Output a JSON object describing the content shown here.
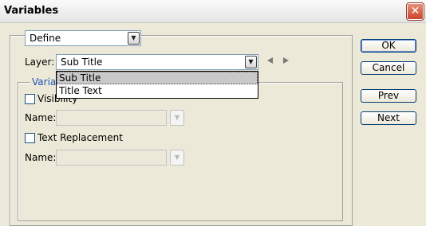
{
  "window": {
    "title": "Variables",
    "close_glyph": "✕"
  },
  "mode_select": {
    "value": "Define"
  },
  "layer": {
    "label": "Layer:",
    "value": "Sub Title",
    "options": [
      "Sub Title",
      "Title Text"
    ],
    "selected_index": 0
  },
  "variable_types": {
    "legend": "Variable Types",
    "legend_visible": "Variab",
    "visibility": {
      "label": "Visibility",
      "checked": false,
      "name_label": "Name:",
      "name_value": ""
    },
    "text_replacement": {
      "label": "Text Replacement",
      "checked": false,
      "name_label": "Name:",
      "name_value": ""
    }
  },
  "buttons": {
    "ok": "OK",
    "cancel": "Cancel",
    "prev": "Prev",
    "next": "Next"
  },
  "icons": {
    "dropdown": "chevron-down-icon",
    "prev_layer": "triangle-left-icon",
    "next_layer": "triangle-right-icon",
    "close": "close-icon"
  },
  "colors": {
    "dialog_bg": "#ece9d8",
    "group_legend": "#1e50b4",
    "close_button": "#c8452c",
    "selected_option": "#c9c9c9"
  }
}
